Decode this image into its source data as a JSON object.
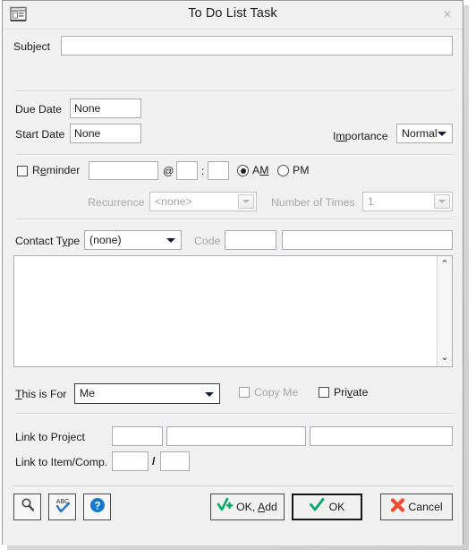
{
  "window": {
    "title": "To Do List Task",
    "icon": "form-window-icon",
    "close_label": "×"
  },
  "subject": {
    "label_pre": "Sub",
    "label_key": "j",
    "label_post": "ect",
    "value": "",
    "placeholder": ""
  },
  "dates": {
    "due_label": "Due Date",
    "due_value": "None",
    "start_label": "Start Date",
    "start_value": "None"
  },
  "importance": {
    "label_pre": "I",
    "label_key": "m",
    "label_post": "portance",
    "value": "Normal"
  },
  "reminder": {
    "label_pre": "R",
    "label_key": "e",
    "label_post": "minder",
    "checked": false,
    "date_value": "",
    "at_symbol": "@",
    "hour_value": "",
    "colon": ":",
    "minute_value": "",
    "am_label_pre": "A",
    "am_label_key": "M",
    "am_selected": true,
    "pm_label": "PM",
    "pm_selected": false
  },
  "recurrence": {
    "label": "Recurrence",
    "value": "<none>",
    "disabled": true,
    "times_label": "Number of Times",
    "times_value": "1"
  },
  "contact": {
    "label_pre": "Contact T",
    "label_key": "y",
    "label_post": "pe",
    "value": "(none)",
    "code_label": "Code",
    "code_value": "",
    "name_value": ""
  },
  "notes": {
    "value": "",
    "scroll_up": "⌃",
    "scroll_down": "⌄"
  },
  "this_is_for": {
    "label_pre": "T",
    "label_key": "h",
    "label_post": "is is For",
    "value": "Me",
    "copy_me_label": "Copy Me",
    "copy_me_checked": false,
    "copy_me_disabled": true,
    "private_pre": "Pri",
    "private_key": "v",
    "private_post": "ate",
    "private_checked": false
  },
  "links": {
    "project_label": "Link to Project",
    "project_code": "",
    "project_name": "",
    "project_extra": "",
    "item_label": "Link to Item/Comp.",
    "item_value": "",
    "slash": "/",
    "comp_value": ""
  },
  "toolbar": {
    "search_icon": "magnifier-icon",
    "spellcheck_icon": "abc-spellcheck-icon",
    "help_icon": "help-question-icon"
  },
  "actions": {
    "ok_add_pre": "OK, ",
    "ok_add_key": "A",
    "ok_add_post": "dd",
    "ok_label": "OK",
    "cancel_label": "Cancel"
  },
  "colors": {
    "accent_green": "#00a86b",
    "accent_red": "#ef4c32",
    "accent_blue": "#1779ce",
    "window_bg": "#f1f1f1",
    "field_border": "#a7adb3",
    "disabled_text": "#a8a8a8"
  }
}
